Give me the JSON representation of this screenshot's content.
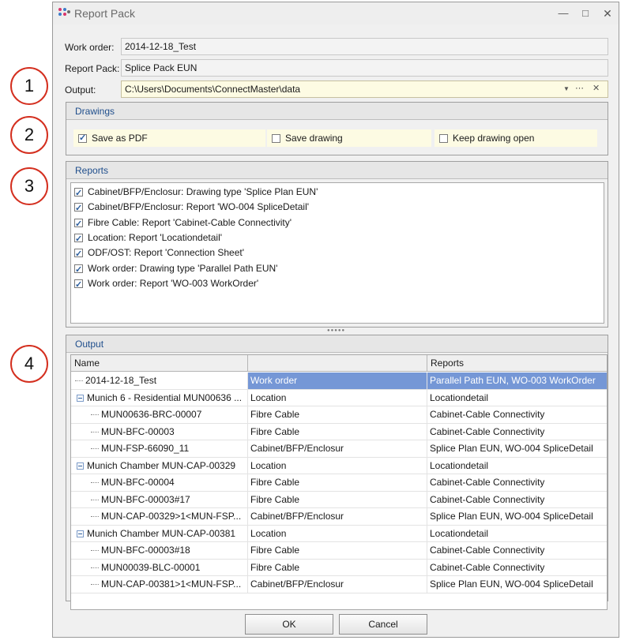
{
  "window": {
    "title": "Report Pack"
  },
  "fields": {
    "work_order_label": "Work order:",
    "work_order_value": "2014-12-18_Test",
    "report_pack_label": "Report Pack:",
    "report_pack_value": "Splice Pack EUN",
    "output_label": "Output:",
    "output_value": "C:\\Users\\Documents\\ConnectMaster\\data"
  },
  "drawings": {
    "title": "Drawings",
    "options": [
      {
        "label": "Save as PDF",
        "checked": true
      },
      {
        "label": "Save drawing",
        "checked": false
      },
      {
        "label": "Keep drawing open",
        "checked": false
      }
    ]
  },
  "reports": {
    "title": "Reports",
    "items": [
      {
        "label": "Cabinet/BFP/Enclosur: Drawing type 'Splice Plan EUN'",
        "checked": true
      },
      {
        "label": "Cabinet/BFP/Enclosur: Report 'WO-004 SpliceDetail'",
        "checked": true
      },
      {
        "label": "Fibre Cable: Report 'Cabinet-Cable Connectivity'",
        "checked": true
      },
      {
        "label": "Location: Report 'Locationdetail'",
        "checked": true
      },
      {
        "label": "ODF/OST: Report 'Connection Sheet'",
        "checked": true
      },
      {
        "label": "Work order: Drawing type 'Parallel Path EUN'",
        "checked": true
      },
      {
        "label": "Work order: Report 'WO-003 WorkOrder'",
        "checked": true
      }
    ]
  },
  "output": {
    "title": "Output",
    "columns": [
      "Name",
      "",
      "Reports"
    ],
    "rows": [
      {
        "name": "2014-12-18_Test",
        "type": "Work order",
        "reports": "Parallel Path EUN, WO-003 WorkOrder",
        "level": 0,
        "expander": false,
        "selected": true
      },
      {
        "name": "Munich 6 - Residential MUN00636 ...",
        "type": "Location",
        "reports": "Locationdetail",
        "level": 0,
        "expander": true,
        "selected": false
      },
      {
        "name": "MUN00636-BRC-00007",
        "type": "Fibre Cable",
        "reports": "Cabinet-Cable Connectivity",
        "level": 1,
        "expander": false,
        "selected": false
      },
      {
        "name": "MUN-BFC-00003",
        "type": "Fibre Cable",
        "reports": "Cabinet-Cable Connectivity",
        "level": 1,
        "expander": false,
        "selected": false
      },
      {
        "name": "MUN-FSP-66090_11",
        "type": "Cabinet/BFP/Enclosur",
        "reports": "Splice Plan EUN, WO-004 SpliceDetail",
        "level": 1,
        "expander": false,
        "selected": false
      },
      {
        "name": "Munich Chamber MUN-CAP-00329",
        "type": "Location",
        "reports": "Locationdetail",
        "level": 0,
        "expander": true,
        "selected": false
      },
      {
        "name": "MUN-BFC-00004",
        "type": "Fibre Cable",
        "reports": "Cabinet-Cable Connectivity",
        "level": 1,
        "expander": false,
        "selected": false
      },
      {
        "name": "MUN-BFC-00003#17",
        "type": "Fibre Cable",
        "reports": "Cabinet-Cable Connectivity",
        "level": 1,
        "expander": false,
        "selected": false
      },
      {
        "name": "MUN-CAP-00329>1<MUN-FSP...",
        "type": "Cabinet/BFP/Enclosur",
        "reports": "Splice Plan EUN, WO-004 SpliceDetail",
        "level": 1,
        "expander": false,
        "selected": false
      },
      {
        "name": "Munich Chamber MUN-CAP-00381",
        "type": "Location",
        "reports": "Locationdetail",
        "level": 0,
        "expander": true,
        "selected": false
      },
      {
        "name": "MUN-BFC-00003#18",
        "type": "Fibre Cable",
        "reports": "Cabinet-Cable Connectivity",
        "level": 1,
        "expander": false,
        "selected": false
      },
      {
        "name": "MUN00039-BLC-00001",
        "type": "Fibre Cable",
        "reports": "Cabinet-Cable Connectivity",
        "level": 1,
        "expander": false,
        "selected": false
      },
      {
        "name": "MUN-CAP-00381>1<MUN-FSP...",
        "type": "Cabinet/BFP/Enclosur",
        "reports": "Splice Plan EUN, WO-004 SpliceDetail",
        "level": 1,
        "expander": false,
        "selected": false
      }
    ]
  },
  "buttons": {
    "ok": "OK",
    "cancel": "Cancel"
  },
  "callouts": [
    "1",
    "2",
    "3",
    "4"
  ],
  "colors": {
    "accent": "#1f4e8c",
    "selection": "#7597d6",
    "highlight_field": "#fdfbe3",
    "callout_ring": "#d42f1f"
  }
}
